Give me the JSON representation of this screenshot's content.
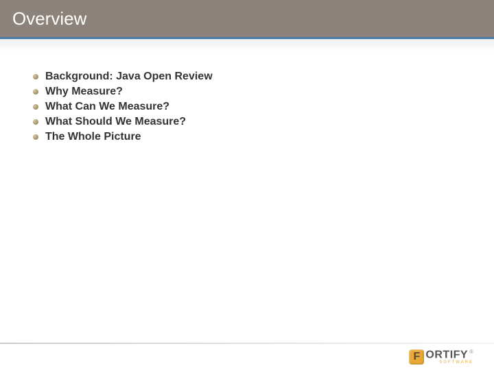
{
  "header": {
    "title": "Overview"
  },
  "bullets": {
    "items": [
      "Background: Java Open Review",
      "Why Measure?",
      "What Can We Measure?",
      "What Should We Measure?",
      "The Whole Picture"
    ]
  },
  "footer": {
    "logo": {
      "icon_letter": "F",
      "text_light": "ORTIFY",
      "subtext": "SOFTWARE",
      "tm": "®"
    }
  }
}
